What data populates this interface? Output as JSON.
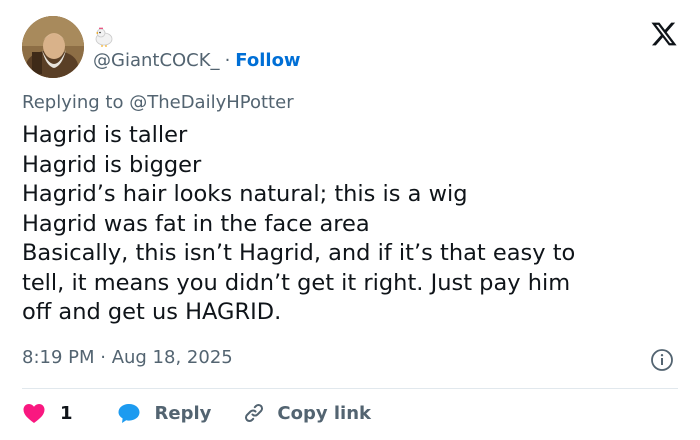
{
  "header": {
    "display_name_emoji": "chicken-icon",
    "handle": "@GiantCOCK_",
    "separator": "·",
    "follow_label": "Follow"
  },
  "reply_context": {
    "prefix": "Replying to",
    "mention": "@TheDailyHPotter"
  },
  "tweet_lines": [
    "Hagrid is taller",
    "Hagrid is bigger",
    "Hagrid’s hair looks natural; this is a wig",
    "Hagrid was fat in the face area",
    "Basically, this isn’t Hagrid, and if it’s that easy to",
    "tell, it means you didn’t get it right. Just pay him",
    "off and get us HAGRID."
  ],
  "timestamp": "8:19 PM · Aug 18, 2025",
  "actions": {
    "like_count": "1",
    "reply_label": "Reply",
    "copy_link_label": "Copy link"
  },
  "colors": {
    "link_blue": "#006fd6",
    "like_red": "#f91880",
    "reply_blue": "#1d9bf0",
    "muted": "#536471",
    "text": "#0f1419"
  }
}
